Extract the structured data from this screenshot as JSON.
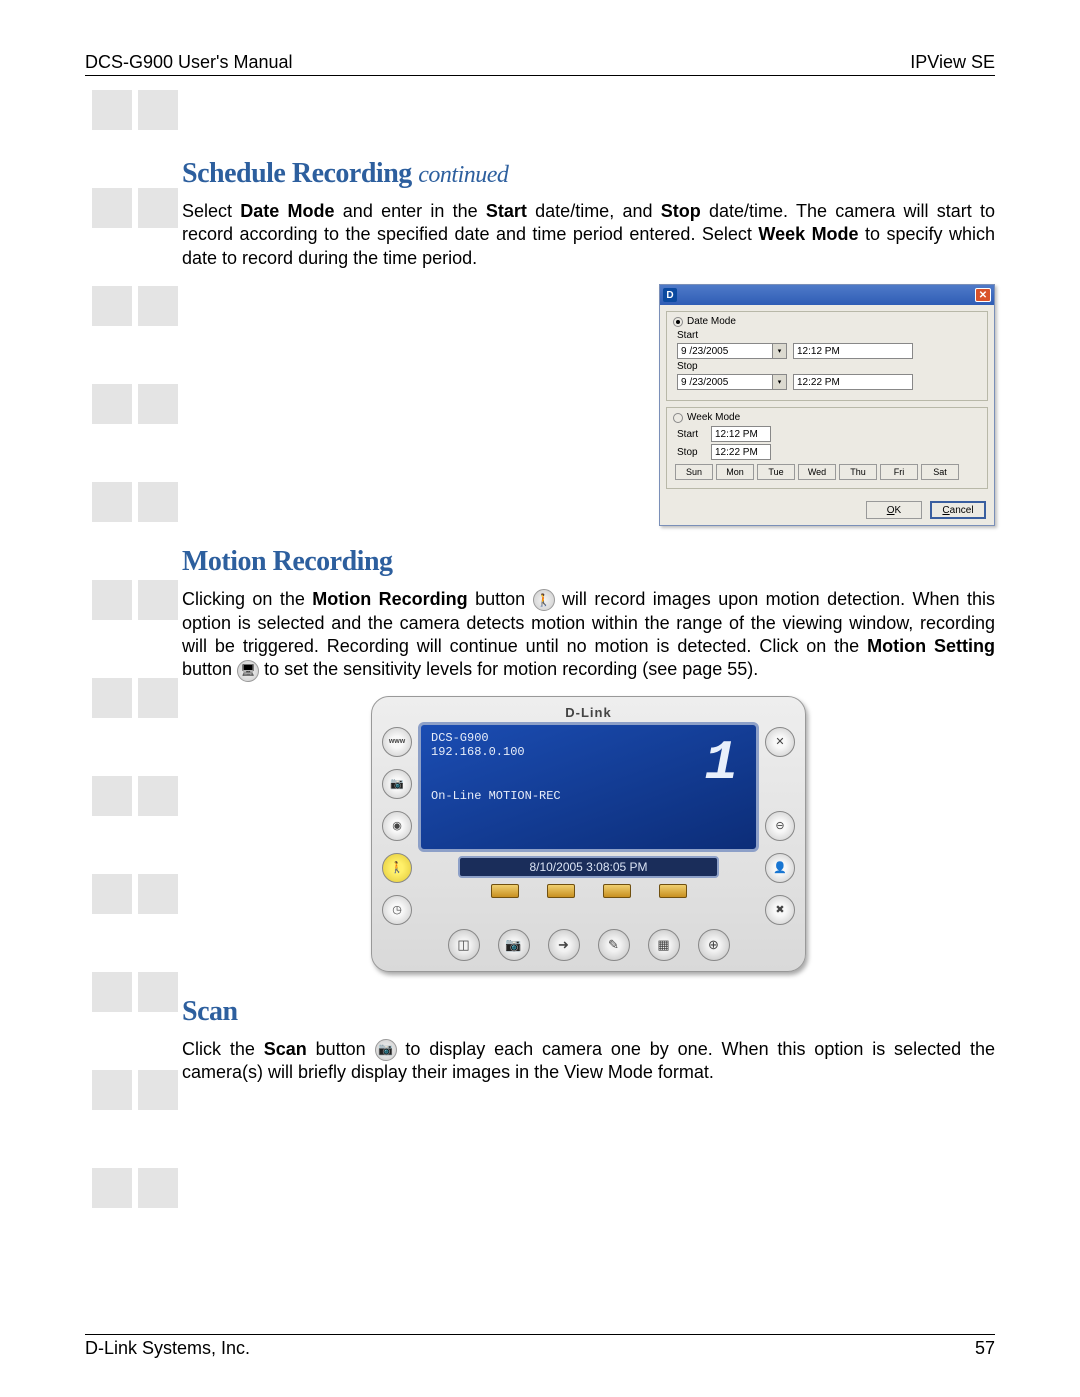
{
  "header": {
    "left": "DCS-G900 User's Manual",
    "right": "IPView SE"
  },
  "footer": {
    "left": "D-Link Systems, Inc.",
    "page": "57"
  },
  "section1": {
    "title": "Schedule Recording",
    "continued": "continued",
    "para": "Select Date Mode and enter in the Start date/time, and Stop date/time. The camera will start to record according to the specified date and time period entered. Select Week Mode to specify which date to record during the time period."
  },
  "dialog": {
    "logo": "D",
    "date_mode_label": "Date Mode",
    "week_mode_label": "Week Mode",
    "start_label": "Start",
    "stop_label": "Stop",
    "date_start_date": "9 /23/2005",
    "date_start_time": "12:12 PM",
    "date_stop_date": "9 /23/2005",
    "date_stop_time": "12:22 PM",
    "week_start_time": "12:12 PM",
    "week_stop_time": "12:22 PM",
    "days": [
      "Sun",
      "Mon",
      "Tue",
      "Wed",
      "Thu",
      "Fri",
      "Sat"
    ],
    "ok": "OK",
    "cancel": "Cancel"
  },
  "section2": {
    "title": "Motion Recording",
    "p1a": "Clicking on the ",
    "p1b_bold": "Motion Recording",
    "p1c": " button ",
    "p1d": " will record images upon motion detection. When this option is selected and the camera detects motion within the range of the viewing window, recording will be triggered. Recording will continue until no motion is detected. Click on the ",
    "p1e_bold": "Motion Setting",
    "p1f": " button ",
    "p1g": " to set the sensitivity levels for motion recording (see page 55)."
  },
  "viewer": {
    "brand": "D-Link",
    "cam_name": "DCS-G900",
    "cam_ip": "192.168.0.100",
    "status": "On-Line MOTION-REC",
    "datetime": "8/10/2005 3:08:05 PM"
  },
  "section3": {
    "title": "Scan",
    "p_a": "Click the ",
    "p_b_bold": "Scan",
    "p_c": " button ",
    "p_d": " to display each camera one by one. When this option is selected the camera(s) will briefly display their images in the View Mode format."
  },
  "icons": {
    "motion": "🚶",
    "motion_setting": "🖥",
    "scan": "📷",
    "www": "www",
    "camera": "📷",
    "record": "◉",
    "clock": "◷",
    "close": "✕",
    "minus": "⊖",
    "person": "👤",
    "tools": "✖",
    "quad": "◫",
    "arrow": "➜",
    "pencil": "✎",
    "grid": "▦",
    "plus": "⊕",
    "chev": "▾"
  }
}
